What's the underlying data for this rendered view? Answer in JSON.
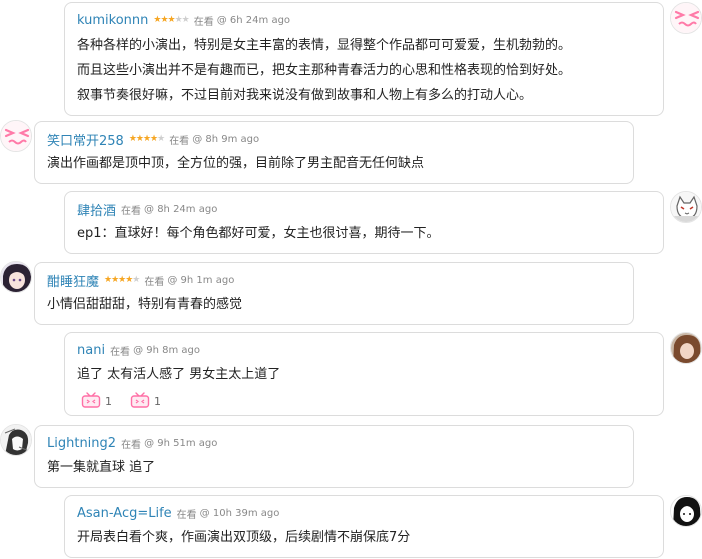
{
  "comments": [
    {
      "user": "kumikonnn",
      "state": "在看",
      "time": "@ 6h 24m ago",
      "rating": 3,
      "avatar_icon": "pink-smiley-avatar",
      "lines": [
        "各种各样的小演出，特别是女主丰富的表情，显得整个作品都可可爱爱，生机勃勃的。",
        "而且这些小演出并不是有趣而已，把女主那种青春活力的心思和性格表现的恰到好处。",
        "叙事节奏很好嘛，不过目前对我来说没有做到故事和人物上有多么的打动人心。"
      ]
    },
    {
      "user": "笑口常开258",
      "state": "在看",
      "time": "@ 8h 9m ago",
      "rating": 4,
      "avatar_icon": "pink-smiley-avatar",
      "lines": [
        "演出作画都是顶中顶，全方位的强，目前除了男主配音无任何缺点"
      ]
    },
    {
      "user": "肆拾酒",
      "state": "在看",
      "time": "@ 8h 24m ago",
      "rating": 0,
      "avatar_icon": "cat-avatar",
      "lines": [
        "ep1：直球好！每个角色都好可爱，女主也很讨喜，期待一下。"
      ]
    },
    {
      "user": "酣睡狂魔",
      "state": "在看",
      "time": "@ 9h 1m ago",
      "rating": 4,
      "avatar_icon": "anime-girl-avatar",
      "lines": [
        "小情侣甜甜甜，特别有青春的感觉"
      ]
    },
    {
      "user": "nani",
      "state": "在看",
      "time": "@ 9h 8m ago",
      "rating": 0,
      "avatar_icon": "brown-hair-avatar",
      "lines": [
        "追了 太有活人感了 男女主太上道了"
      ],
      "reactions": [
        {
          "icon": "bilibili-tv-icon",
          "count": "1"
        },
        {
          "icon": "bilibili-tv-icon",
          "count": "1"
        }
      ]
    },
    {
      "user": "Lightning2",
      "state": "在看",
      "time": "@ 9h 51m ago",
      "rating": 0,
      "avatar_icon": "manga-avatar",
      "lines": [
        "第一集就直球 追了"
      ]
    },
    {
      "user": "Asan-Acg=Life",
      "state": "在看",
      "time": "@ 10h 39m ago",
      "rating": 0,
      "avatar_icon": "black-hair-avatar",
      "lines": [
        "开局表白看个爽，作画演出双顶级，后续剧情不崩保底7分"
      ]
    }
  ],
  "colors": {
    "username": "#2f84b6",
    "star_on": "#f6a623",
    "star_off": "#cfcfcf",
    "reaction_pink": "#ff6fa6"
  }
}
